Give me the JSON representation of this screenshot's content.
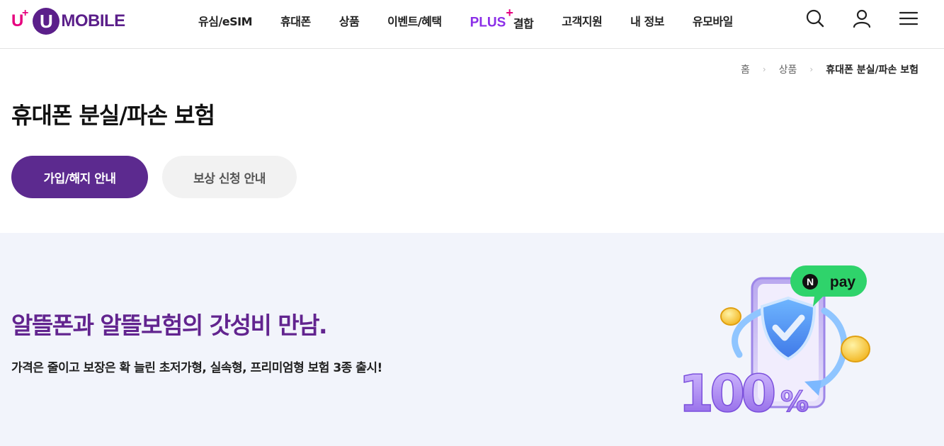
{
  "header": {
    "logo": {
      "brand_prefix": "U",
      "brand_plus": "+",
      "brand_circle": "U",
      "brand_text": "MOBILE"
    },
    "nav": [
      {
        "label": "유심/eSIM"
      },
      {
        "label": "휴대폰"
      },
      {
        "label": "상품"
      },
      {
        "label": "이벤트/혜택"
      },
      {
        "plus_word": "PLUS",
        "plus_mark": "+",
        "label": "결합"
      },
      {
        "label": "고객지원"
      },
      {
        "label": "내 정보"
      },
      {
        "label": "유모바일"
      }
    ],
    "icons": {
      "search": "search-icon",
      "user": "user-icon",
      "menu": "menu-icon"
    }
  },
  "breadcrumb": [
    {
      "label": "홈"
    },
    {
      "label": "상품"
    },
    {
      "label": "휴대폰 분실/파손 보험"
    }
  ],
  "page": {
    "title": "휴대폰 분실/파손 보험"
  },
  "tabs": [
    {
      "label": "가입/해지 안내",
      "active": true
    },
    {
      "label": "보상 신청 안내",
      "active": false
    }
  ],
  "banner": {
    "title": "알뜰폰과 알뜰보험의 갓성비 만남.",
    "subtitle": "가격은 줄이고 보장은 확 늘린 초저가형, 실속형, 프리미엄형 보험 3종 출시!",
    "illustration": {
      "badge_n": "N",
      "badge_text": "pay",
      "big_text": "100",
      "percent": "%"
    }
  },
  "colors": {
    "brand_purple": "#5c2a8f",
    "brand_magenta": "#e6007e",
    "banner_bg": "#f2f4fb",
    "npay_green": "#2fd36b"
  }
}
